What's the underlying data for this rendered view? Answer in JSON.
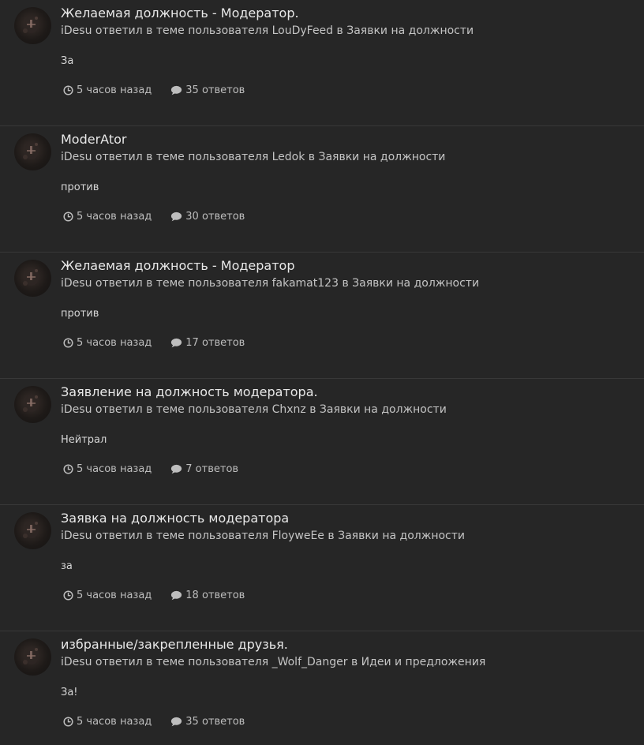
{
  "colors": {
    "background": "#262626",
    "divider": "#383838",
    "title": "#e8e8e8",
    "meta": "#c4c4c4",
    "stats": "#bdbdbd"
  },
  "icons": {
    "time": "clock-icon",
    "replies": "comment-icon"
  },
  "items": [
    {
      "title": "Желаемая должность - Модератор.",
      "user": "iDesu",
      "action": "ответил в теме пользователя",
      "author": "LouDyFeed",
      "in": "в",
      "forum": "Заявки на должности",
      "excerpt": "За",
      "time": "5 часов назад",
      "replies": "35 ответов"
    },
    {
      "title": "ModerAtor",
      "user": "iDesu",
      "action": "ответил в теме пользователя",
      "author": "Ledok",
      "in": "в",
      "forum": "Заявки на должности",
      "excerpt": "против",
      "time": "5 часов назад",
      "replies": "30 ответов"
    },
    {
      "title": "Желаемая должность - Модератор",
      "user": "iDesu",
      "action": "ответил в теме пользователя",
      "author": "fakamat123",
      "in": "в",
      "forum": "Заявки на должности",
      "excerpt": "против",
      "time": "5 часов назад",
      "replies": "17 ответов"
    },
    {
      "title": "Заявление на должность модератора.",
      "user": "iDesu",
      "action": "ответил в теме пользователя",
      "author": "Chxnz",
      "in": "в",
      "forum": "Заявки на должности",
      "excerpt": "Нейтрал",
      "time": "5 часов назад",
      "replies": "7 ответов"
    },
    {
      "title": "Заявка на должность модератора",
      "user": "iDesu",
      "action": "ответил в теме пользователя",
      "author": "FloyweEe",
      "in": "в",
      "forum": "Заявки на должности",
      "excerpt": "за",
      "time": "5 часов назад",
      "replies": "18 ответов"
    },
    {
      "title": "избранные/закрепленные друзья.",
      "user": "iDesu",
      "action": "ответил в теме пользователя",
      "author": "_Wolf_Danger",
      "in": "в",
      "forum": "Идеи и предложения",
      "excerpt": "За!",
      "time": "5 часов назад",
      "replies": "35 ответов"
    }
  ]
}
